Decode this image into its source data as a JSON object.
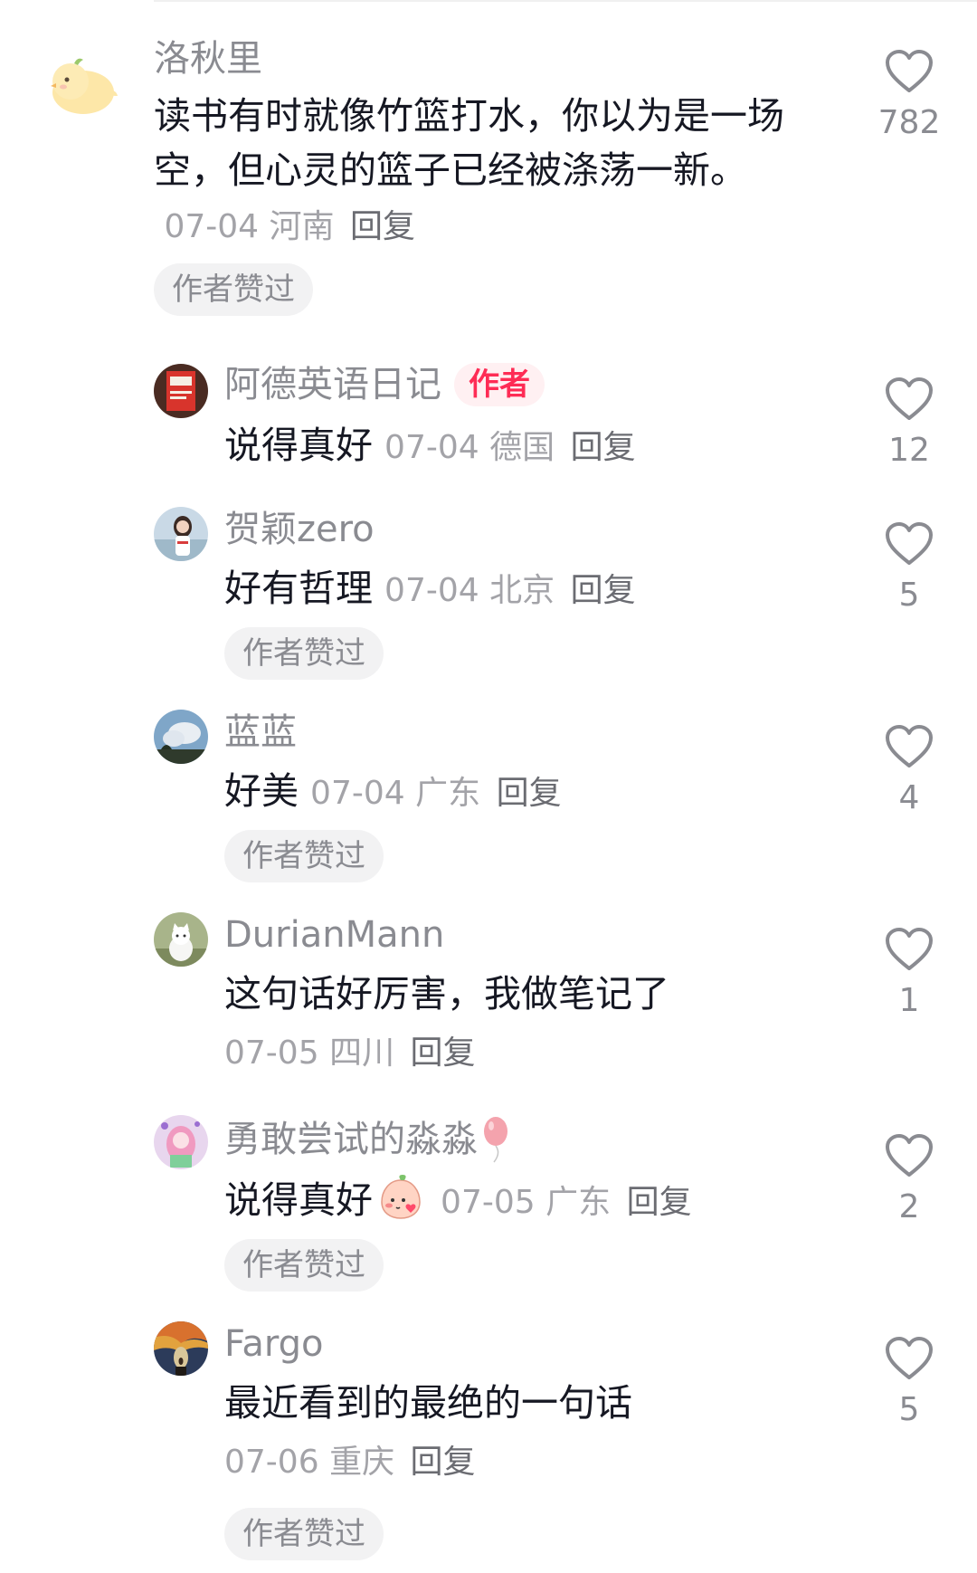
{
  "comments": [
    {
      "username": "洛秋里",
      "text": "读书有时就像竹篮打水，你以为是一场空，但心灵的篮子已经被涤荡一新。",
      "date": "07-04",
      "location": "河南",
      "reply": "回复",
      "liked_tag": "作者赞过",
      "likes": "782",
      "avatar_icon": "chick-avatar"
    },
    {
      "username": "阿德英语日记",
      "author_badge": "作者",
      "text": "说得真好",
      "date": "07-04",
      "location": "德国",
      "reply": "回复",
      "likes": "12",
      "avatar_icon": "book-avatar"
    },
    {
      "username": "贺颖zero",
      "text": "好有哲理",
      "date": "07-04",
      "location": "北京",
      "reply": "回复",
      "liked_tag": "作者赞过",
      "likes": "5",
      "avatar_icon": "person-avatar"
    },
    {
      "username": "蓝蓝",
      "text": "好美",
      "date": "07-04",
      "location": "广东",
      "reply": "回复",
      "liked_tag": "作者赞过",
      "likes": "4",
      "avatar_icon": "sky-avatar"
    },
    {
      "username": "DurianMann",
      "text": "这句话好厉害，我做笔记了",
      "date": "07-05",
      "location": "四川",
      "reply": "回复",
      "likes": "1",
      "avatar_icon": "cat-avatar"
    },
    {
      "username": "勇敢尝试的淼淼",
      "username_icon": "balloon-icon",
      "text": "说得真好",
      "text_icon": "blushing-peach-emoji",
      "date": "07-05",
      "location": "广东",
      "reply": "回复",
      "liked_tag": "作者赞过",
      "likes": "2",
      "avatar_icon": "anime-girl-avatar"
    },
    {
      "username": "Fargo",
      "text": "最近看到的最绝的一句话",
      "date": "07-06",
      "location": "重庆",
      "reply": "回复",
      "liked_tag": "作者赞过",
      "likes": "5",
      "avatar_icon": "scream-painting-avatar"
    }
  ],
  "colors": {
    "text_primary": "#161823",
    "text_secondary": "#8a8b91",
    "accent": "#fe2c55",
    "chip_bg": "#f2f2f3"
  }
}
